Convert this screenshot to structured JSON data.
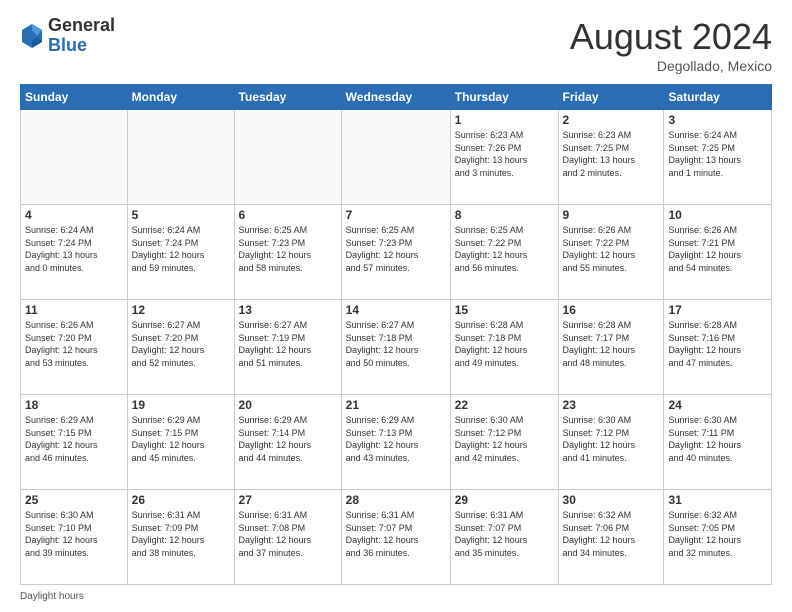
{
  "logo": {
    "general": "General",
    "blue": "Blue"
  },
  "header": {
    "month_year": "August 2024",
    "location": "Degollado, Mexico"
  },
  "days_of_week": [
    "Sunday",
    "Monday",
    "Tuesday",
    "Wednesday",
    "Thursday",
    "Friday",
    "Saturday"
  ],
  "weeks": [
    [
      {
        "day": "",
        "info": ""
      },
      {
        "day": "",
        "info": ""
      },
      {
        "day": "",
        "info": ""
      },
      {
        "day": "",
        "info": ""
      },
      {
        "day": "1",
        "info": "Sunrise: 6:23 AM\nSunset: 7:26 PM\nDaylight: 13 hours\nand 3 minutes."
      },
      {
        "day": "2",
        "info": "Sunrise: 6:23 AM\nSunset: 7:25 PM\nDaylight: 13 hours\nand 2 minutes."
      },
      {
        "day": "3",
        "info": "Sunrise: 6:24 AM\nSunset: 7:25 PM\nDaylight: 13 hours\nand 1 minute."
      }
    ],
    [
      {
        "day": "4",
        "info": "Sunrise: 6:24 AM\nSunset: 7:24 PM\nDaylight: 13 hours\nand 0 minutes."
      },
      {
        "day": "5",
        "info": "Sunrise: 6:24 AM\nSunset: 7:24 PM\nDaylight: 12 hours\nand 59 minutes."
      },
      {
        "day": "6",
        "info": "Sunrise: 6:25 AM\nSunset: 7:23 PM\nDaylight: 12 hours\nand 58 minutes."
      },
      {
        "day": "7",
        "info": "Sunrise: 6:25 AM\nSunset: 7:23 PM\nDaylight: 12 hours\nand 57 minutes."
      },
      {
        "day": "8",
        "info": "Sunrise: 6:25 AM\nSunset: 7:22 PM\nDaylight: 12 hours\nand 56 minutes."
      },
      {
        "day": "9",
        "info": "Sunrise: 6:26 AM\nSunset: 7:22 PM\nDaylight: 12 hours\nand 55 minutes."
      },
      {
        "day": "10",
        "info": "Sunrise: 6:26 AM\nSunset: 7:21 PM\nDaylight: 12 hours\nand 54 minutes."
      }
    ],
    [
      {
        "day": "11",
        "info": "Sunrise: 6:26 AM\nSunset: 7:20 PM\nDaylight: 12 hours\nand 53 minutes."
      },
      {
        "day": "12",
        "info": "Sunrise: 6:27 AM\nSunset: 7:20 PM\nDaylight: 12 hours\nand 52 minutes."
      },
      {
        "day": "13",
        "info": "Sunrise: 6:27 AM\nSunset: 7:19 PM\nDaylight: 12 hours\nand 51 minutes."
      },
      {
        "day": "14",
        "info": "Sunrise: 6:27 AM\nSunset: 7:18 PM\nDaylight: 12 hours\nand 50 minutes."
      },
      {
        "day": "15",
        "info": "Sunrise: 6:28 AM\nSunset: 7:18 PM\nDaylight: 12 hours\nand 49 minutes."
      },
      {
        "day": "16",
        "info": "Sunrise: 6:28 AM\nSunset: 7:17 PM\nDaylight: 12 hours\nand 48 minutes."
      },
      {
        "day": "17",
        "info": "Sunrise: 6:28 AM\nSunset: 7:16 PM\nDaylight: 12 hours\nand 47 minutes."
      }
    ],
    [
      {
        "day": "18",
        "info": "Sunrise: 6:29 AM\nSunset: 7:15 PM\nDaylight: 12 hours\nand 46 minutes."
      },
      {
        "day": "19",
        "info": "Sunrise: 6:29 AM\nSunset: 7:15 PM\nDaylight: 12 hours\nand 45 minutes."
      },
      {
        "day": "20",
        "info": "Sunrise: 6:29 AM\nSunset: 7:14 PM\nDaylight: 12 hours\nand 44 minutes."
      },
      {
        "day": "21",
        "info": "Sunrise: 6:29 AM\nSunset: 7:13 PM\nDaylight: 12 hours\nand 43 minutes."
      },
      {
        "day": "22",
        "info": "Sunrise: 6:30 AM\nSunset: 7:12 PM\nDaylight: 12 hours\nand 42 minutes."
      },
      {
        "day": "23",
        "info": "Sunrise: 6:30 AM\nSunset: 7:12 PM\nDaylight: 12 hours\nand 41 minutes."
      },
      {
        "day": "24",
        "info": "Sunrise: 6:30 AM\nSunset: 7:11 PM\nDaylight: 12 hours\nand 40 minutes."
      }
    ],
    [
      {
        "day": "25",
        "info": "Sunrise: 6:30 AM\nSunset: 7:10 PM\nDaylight: 12 hours\nand 39 minutes."
      },
      {
        "day": "26",
        "info": "Sunrise: 6:31 AM\nSunset: 7:09 PM\nDaylight: 12 hours\nand 38 minutes."
      },
      {
        "day": "27",
        "info": "Sunrise: 6:31 AM\nSunset: 7:08 PM\nDaylight: 12 hours\nand 37 minutes."
      },
      {
        "day": "28",
        "info": "Sunrise: 6:31 AM\nSunset: 7:07 PM\nDaylight: 12 hours\nand 36 minutes."
      },
      {
        "day": "29",
        "info": "Sunrise: 6:31 AM\nSunset: 7:07 PM\nDaylight: 12 hours\nand 35 minutes."
      },
      {
        "day": "30",
        "info": "Sunrise: 6:32 AM\nSunset: 7:06 PM\nDaylight: 12 hours\nand 34 minutes."
      },
      {
        "day": "31",
        "info": "Sunrise: 6:32 AM\nSunset: 7:05 PM\nDaylight: 12 hours\nand 32 minutes."
      }
    ]
  ],
  "footer": {
    "daylight_hours": "Daylight hours"
  }
}
